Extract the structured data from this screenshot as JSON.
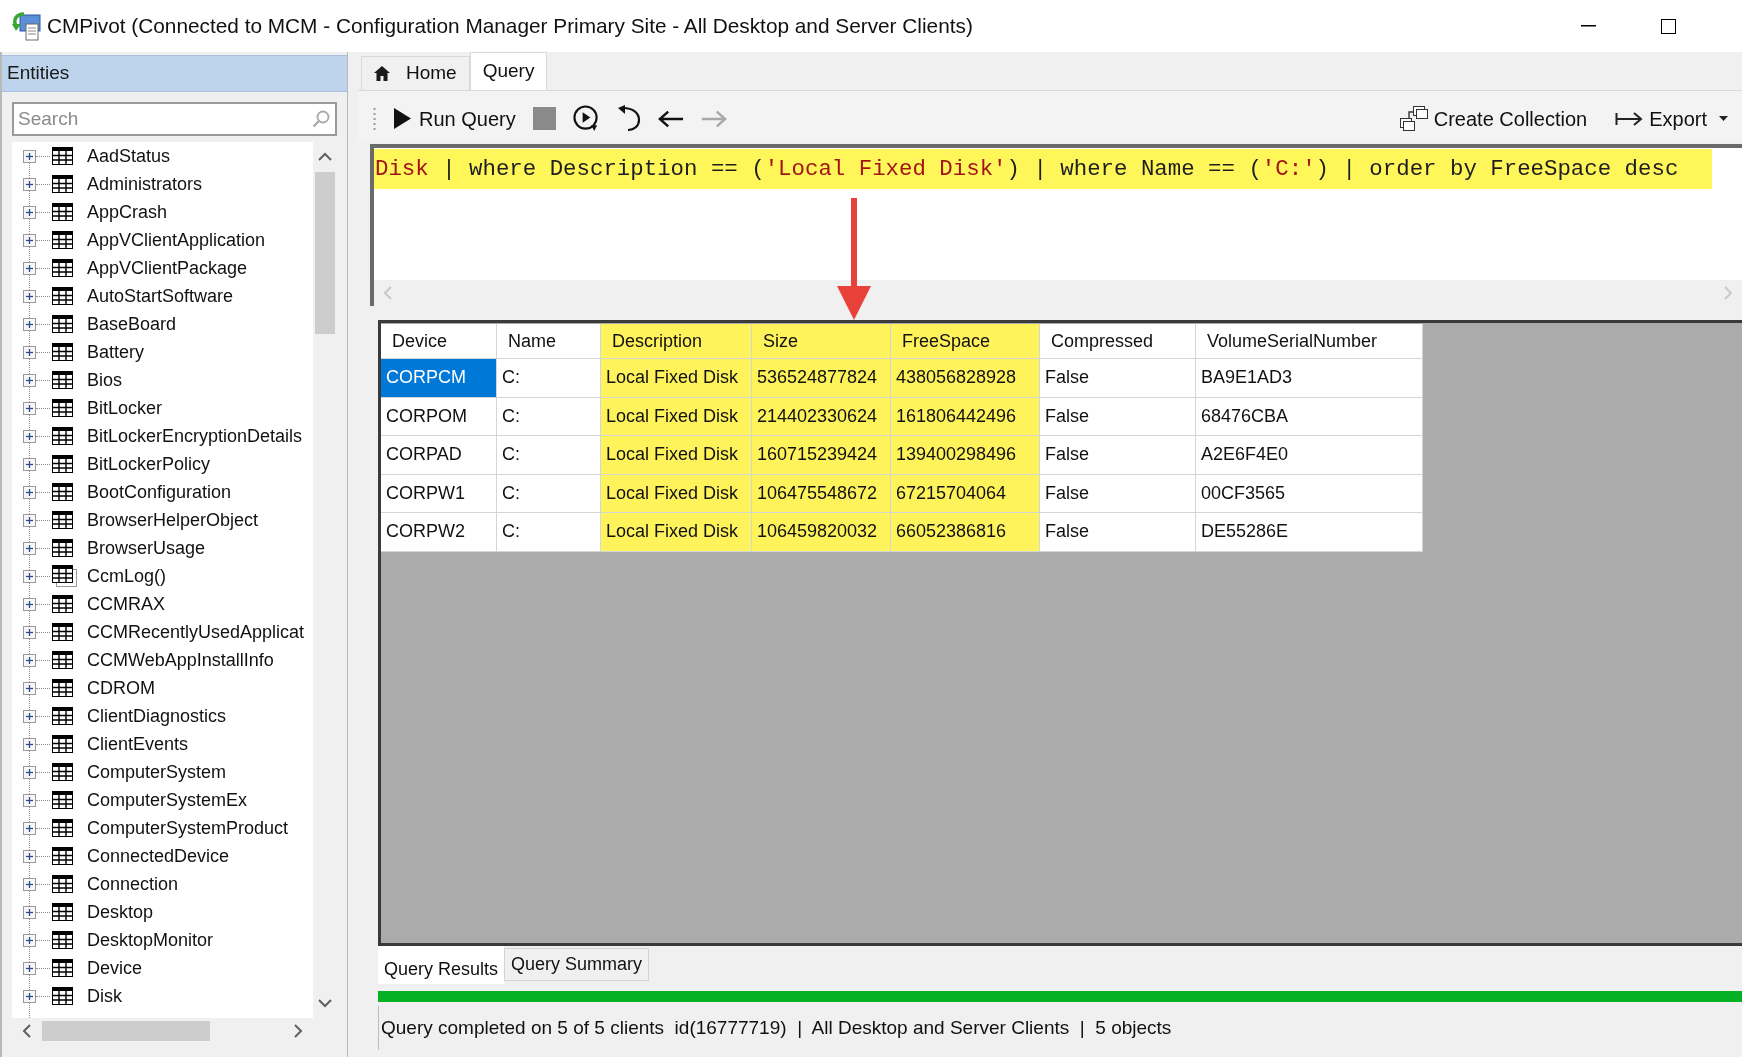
{
  "window": {
    "title": "CMPivot (Connected to MCM - Configuration Manager Primary Site - All Desktop and Server Clients)"
  },
  "sidebar": {
    "header": "Entities",
    "search": {
      "placeholder": "Search"
    },
    "items": [
      {
        "label": "AadStatus",
        "kind": "table",
        "expanded": false
      },
      {
        "label": "Administrators",
        "kind": "table",
        "expanded": false
      },
      {
        "label": "AppCrash",
        "kind": "table",
        "expanded": false
      },
      {
        "label": "AppVClientApplication",
        "kind": "table",
        "expanded": false
      },
      {
        "label": "AppVClientPackage",
        "kind": "table",
        "expanded": false
      },
      {
        "label": "AutoStartSoftware",
        "kind": "table",
        "expanded": false
      },
      {
        "label": "BaseBoard",
        "kind": "table",
        "expanded": false
      },
      {
        "label": "Battery",
        "kind": "table",
        "expanded": false
      },
      {
        "label": "Bios",
        "kind": "table",
        "expanded": false
      },
      {
        "label": "BitLocker",
        "kind": "table",
        "expanded": false
      },
      {
        "label": "BitLockerEncryptionDetails",
        "kind": "table",
        "expanded": false
      },
      {
        "label": "BitLockerPolicy",
        "kind": "table",
        "expanded": false
      },
      {
        "label": "BootConfiguration",
        "kind": "table",
        "expanded": false
      },
      {
        "label": "BrowserHelperObject",
        "kind": "table",
        "expanded": false
      },
      {
        "label": "BrowserUsage",
        "kind": "table",
        "expanded": false
      },
      {
        "label": "CcmLog()",
        "kind": "function",
        "expanded": false
      },
      {
        "label": "CCMRAX",
        "kind": "table",
        "expanded": false
      },
      {
        "label": "CCMRecentlyUsedApplicat",
        "kind": "table",
        "expanded": false
      },
      {
        "label": "CCMWebAppInstallInfo",
        "kind": "table",
        "expanded": false
      },
      {
        "label": "CDROM",
        "kind": "table",
        "expanded": false
      },
      {
        "label": "ClientDiagnostics",
        "kind": "table",
        "expanded": false
      },
      {
        "label": "ClientEvents",
        "kind": "table",
        "expanded": false
      },
      {
        "label": "ComputerSystem",
        "kind": "table",
        "expanded": false
      },
      {
        "label": "ComputerSystemEx",
        "kind": "table",
        "expanded": false
      },
      {
        "label": "ComputerSystemProduct",
        "kind": "table",
        "expanded": false
      },
      {
        "label": "ConnectedDevice",
        "kind": "table",
        "expanded": false
      },
      {
        "label": "Connection",
        "kind": "table",
        "expanded": false
      },
      {
        "label": "Desktop",
        "kind": "table",
        "expanded": false
      },
      {
        "label": "DesktopMonitor",
        "kind": "table",
        "expanded": false
      },
      {
        "label": "Device",
        "kind": "table",
        "expanded": false
      },
      {
        "label": "Disk",
        "kind": "table",
        "expanded": false
      }
    ]
  },
  "tabs": [
    {
      "label": "Home",
      "kind": "home",
      "selected": false
    },
    {
      "label": "Query",
      "kind": "plain",
      "selected": true
    }
  ],
  "toolbar": {
    "left": [
      {
        "kind": "run",
        "label": "Run Query",
        "disabled": false
      },
      {
        "kind": "stop",
        "disabled": true
      },
      {
        "kind": "run_selection",
        "disabled": false
      },
      {
        "kind": "undo",
        "disabled": false
      },
      {
        "kind": "back",
        "disabled": false
      },
      {
        "kind": "forward",
        "disabled": true
      }
    ],
    "right": [
      {
        "kind": "collection",
        "label": "Create Collection",
        "dropdown": false
      },
      {
        "kind": "export",
        "label": "Export",
        "dropdown": true
      }
    ]
  },
  "query": {
    "highlighted": true,
    "tokens": [
      {
        "kind": "entity",
        "text": "Disk"
      },
      {
        "kind": "plain",
        "text": " | where Description == ("
      },
      {
        "kind": "string",
        "text": "'Local Fixed Disk'"
      },
      {
        "kind": "plain",
        "text": ") | where Name == ("
      },
      {
        "kind": "string",
        "text": "'C:'"
      },
      {
        "kind": "plain",
        "text": ") | order by FreeSpace desc"
      }
    ]
  },
  "results": {
    "columns": [
      {
        "label": "Device",
        "highlighted": false
      },
      {
        "label": "Name",
        "highlighted": false
      },
      {
        "label": "Description",
        "highlighted": true
      },
      {
        "label": "Size",
        "highlighted": true
      },
      {
        "label": "FreeSpace",
        "highlighted": true
      },
      {
        "label": "Compressed",
        "highlighted": false
      },
      {
        "label": "VolumeSerialNumber",
        "highlighted": false
      }
    ],
    "rows": [
      {
        "selected": true,
        "cells": [
          "CORPCM",
          "C:",
          "Local Fixed Disk",
          "536524877824",
          "438056828928",
          "False",
          "BA9E1AD3"
        ]
      },
      {
        "selected": false,
        "cells": [
          "CORPOM",
          "C:",
          "Local Fixed Disk",
          "214402330624",
          "161806442496",
          "False",
          "68476CBA"
        ]
      },
      {
        "selected": false,
        "cells": [
          "CORPAD",
          "C:",
          "Local Fixed Disk",
          "160715239424",
          "139400298496",
          "False",
          "A2E6F4E0"
        ]
      },
      {
        "selected": false,
        "cells": [
          "CORPW1",
          "C:",
          "Local Fixed Disk",
          "106475548672",
          "67215704064",
          "False",
          "00CF3565"
        ]
      },
      {
        "selected": false,
        "cells": [
          "CORPW2",
          "C:",
          "Local Fixed Disk",
          "106459820032",
          "66052386816",
          "False",
          "DE55286E"
        ]
      }
    ]
  },
  "bottom_tabs": [
    {
      "label": "Query Results",
      "selected": true
    },
    {
      "label": "Query Summary",
      "selected": false
    }
  ],
  "progress": {
    "level": 1
  },
  "status_bar": {
    "text": "Query completed on 5 of 5 clients  id(16777719)  |  All Desktop and Server Clients  |  5 objects"
  }
}
